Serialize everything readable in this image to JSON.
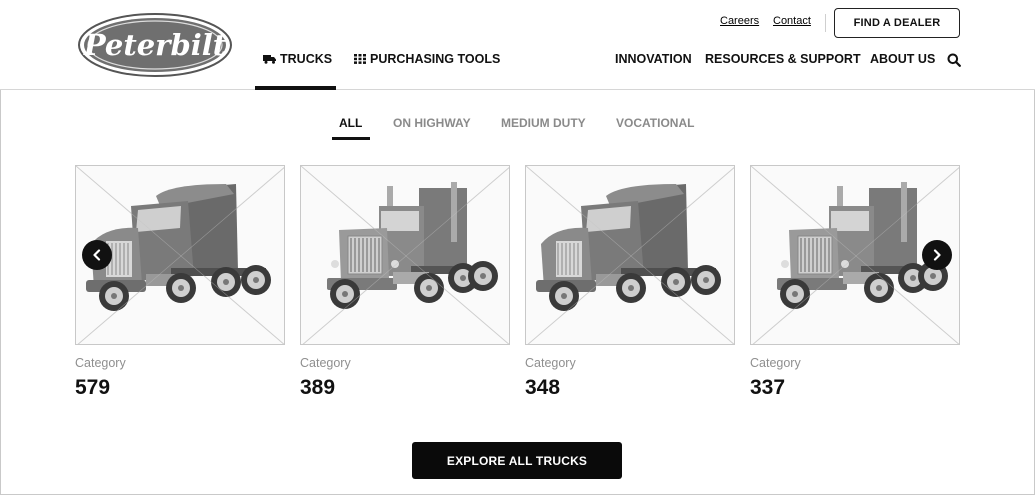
{
  "brand": {
    "logo_text": "Peterbilt"
  },
  "utility_nav": {
    "careers": "Careers",
    "contact": "Contact",
    "dealer_button": "FIND A DEALER"
  },
  "main_nav": {
    "trucks": "TRUCKS",
    "purchasing_tools": "PURCHASING TOOLS",
    "innovation": "INNOVATION",
    "resources_support": "RESOURCES & SUPPORT",
    "about_us": "ABOUT US"
  },
  "filter_tabs": [
    {
      "label": "ALL",
      "active": true
    },
    {
      "label": "ON HIGHWAY",
      "active": false
    },
    {
      "label": "MEDIUM DUTY",
      "active": false
    },
    {
      "label": "VOCATIONAL",
      "active": false
    }
  ],
  "cards": [
    {
      "category": "Category",
      "number": "579",
      "model_style": "aero"
    },
    {
      "category": "Category",
      "number": "389",
      "model_style": "classic"
    },
    {
      "category": "Category",
      "number": "348",
      "model_style": "aero"
    },
    {
      "category": "Category",
      "number": "337",
      "model_style": "classic"
    }
  ],
  "cta": {
    "label": "EXPLORE ALL TRUCKS"
  },
  "icons": {
    "truck": "truck-icon",
    "grid": "grid-icon",
    "search": "search-icon",
    "prev": "chevron-left-icon",
    "next": "chevron-right-icon"
  },
  "colors": {
    "primary": "#111111",
    "inactive_tab": "#8a8a8a",
    "category_text": "#8f8f8f",
    "border": "#c8c8c8"
  }
}
